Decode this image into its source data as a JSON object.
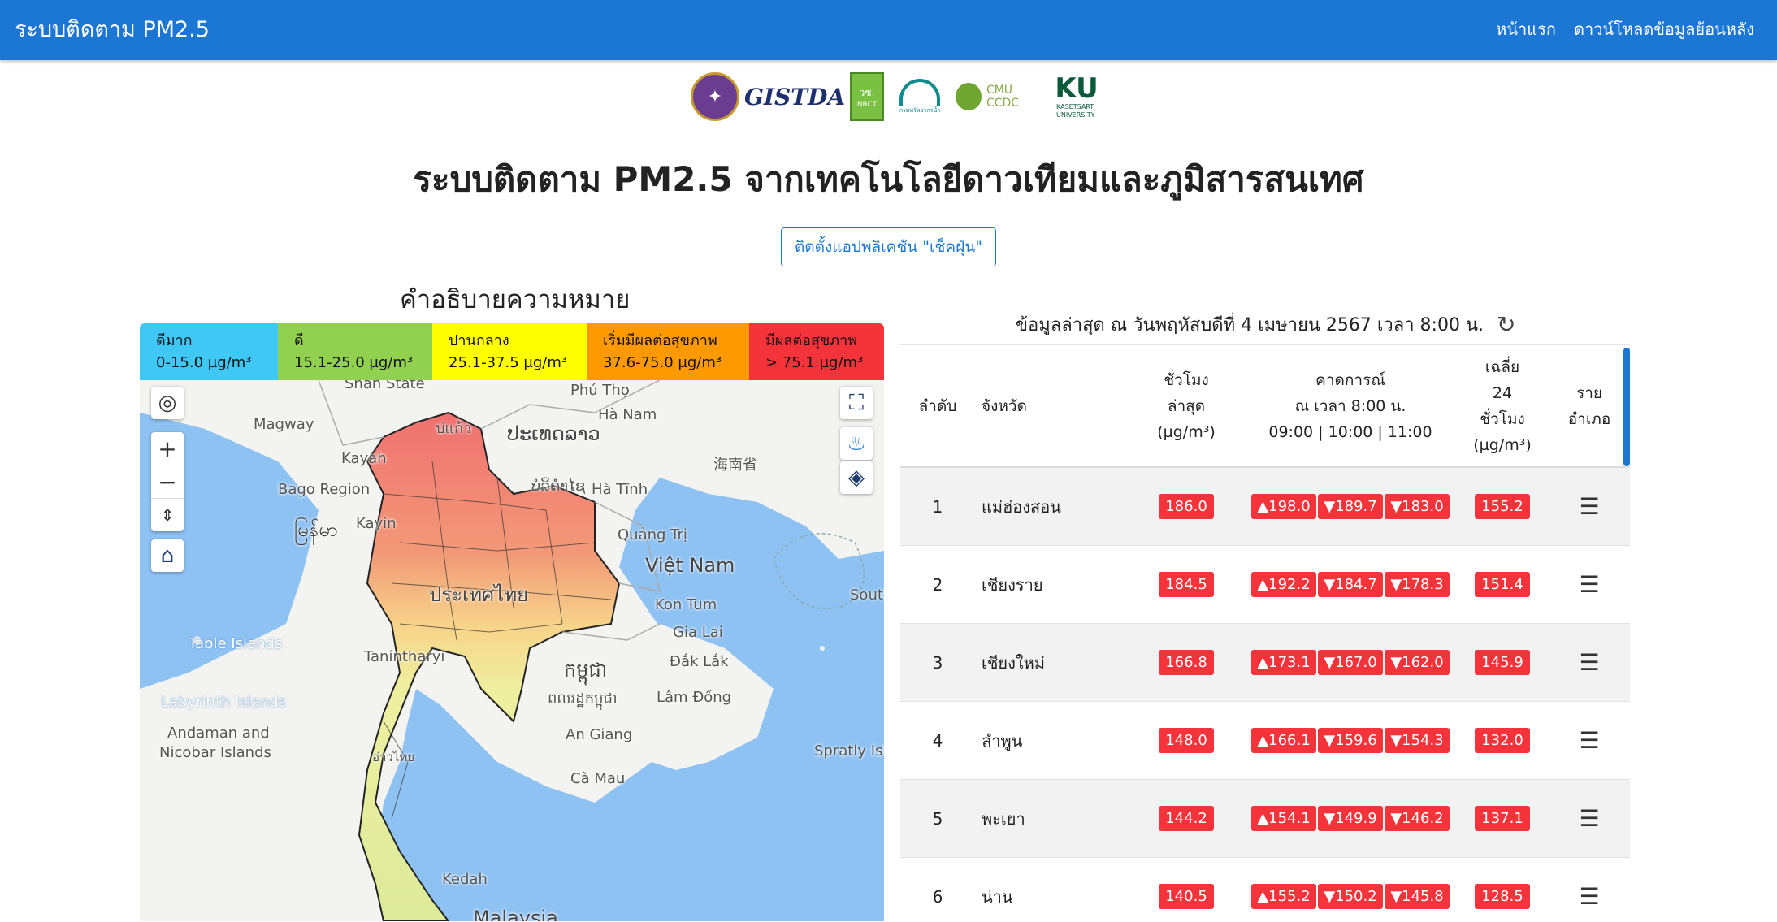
{
  "navbar": {
    "brand": "ระบบติดตาม PM2.5",
    "links": [
      "หน้าแรก",
      "ดาวน์โหลดข้อมูลย้อนหลัง"
    ]
  },
  "logos": {
    "gistda": "GISTDA",
    "nrct": "วช.",
    "nrct_sub": "NRCT",
    "dept": "กรมทรัพยากรน้ำ",
    "ccdc": "CMU CCDC",
    "ku": "KU",
    "ku_sub": "KASETSART UNIVERSITY"
  },
  "page_title": "ระบบติดตาม PM2.5 จากเทคโนโลยีดาวเทียมและภูมิสารสนเทศ",
  "install_button": "ติดตั้งแอปพลิเคชัน \"เช็คฝุ่น\"",
  "legend": {
    "title": "คำอธิบายความหมาย",
    "items": [
      {
        "label": "ดีมาก",
        "range": "0-15.0 µg/m³",
        "color": "#3fc7f5"
      },
      {
        "label": "ดี",
        "range": "15.1-25.0 µg/m³",
        "color": "#92d050"
      },
      {
        "label": "ปานกลาง",
        "range": "25.1-37.5 µg/m³",
        "color": "#ffff00"
      },
      {
        "label": "เริ่มมีผลต่อสุขภาพ",
        "range": "37.6-75.0 µg/m³",
        "color": "#ff9900"
      },
      {
        "label": "มีผลต่อสุขภาพ",
        "range": "> 75.1 µg/m³",
        "color": "#f5333a"
      }
    ]
  },
  "map": {
    "labels": {
      "shan": "Shan State",
      "phutho": "Phú Thọ",
      "hanam": "Hà Nam",
      "magway": "Magway",
      "bokeo": "บ่แก้ว",
      "laos": "ປະເທດລາວ",
      "hainan": "海南省",
      "kayah": "Kayah",
      "bago": "Bago Region",
      "bolikhamxay": "ບໍລິຄໍາໄຊ",
      "hatinh": "Hà Tĩnh",
      "myanmar": "မြန်မာ",
      "kayin": "Kayin",
      "quangtri": "Quảng Trị",
      "vietnam": "Việt Nam",
      "thailand": "ประเทศไทย",
      "south": "South",
      "kontum": "Kon Tum",
      "gialai": "Gia Lai",
      "table_islands": "Table Islands",
      "tanintharyi": "Tanintharyi",
      "daklak": "Đắk Lắk",
      "cambodia": "កម្ពុជា",
      "cambodia2": "ពលរដ្ឋកម្ពុជា",
      "labyrinth": "Labyrinth Islands",
      "lamdong": "Lâm Đồng",
      "andaman": "Andaman and",
      "nicobar": "Nicobar Islands",
      "angiang": "An Giang",
      "spratly": "Spratly Isla",
      "gulf": "อ่าวไทย",
      "camau": "Cà Mau",
      "kedah": "Kedah",
      "malaysia": "Malaysia"
    }
  },
  "updated": "ข้อมูลล่าสุด ณ วันพฤหัสบดีที่ 4 เมษายน 2567 เวลา 8:00 น.",
  "table": {
    "headers": {
      "rank": "ลำดับ",
      "province": "จังหวัด",
      "hour_1": "ชั่วโมง",
      "hour_2": "ล่าสุด",
      "hour_3": "(µg/m³)",
      "fc_1": "คาดการณ์",
      "fc_2": "ณ เวลา 8:00 น.",
      "fc_3": "09:00 | 10:00 | 11:00",
      "avg_1": "เฉลี่ย",
      "avg_2": "24",
      "avg_3": "ชั่วโมง",
      "avg_4": "(µg/m³)",
      "district_1": "ราย",
      "district_2": "อำเภอ"
    },
    "rows": [
      {
        "rank": "1",
        "province": "แม่ฮ่องสอน",
        "latest": "186.0",
        "f1": "▲198.0",
        "f2": "▼189.7",
        "f3": "▼183.0",
        "avg": "155.2"
      },
      {
        "rank": "2",
        "province": "เชียงราย",
        "latest": "184.5",
        "f1": "▲192.2",
        "f2": "▼184.7",
        "f3": "▼178.3",
        "avg": "151.4"
      },
      {
        "rank": "3",
        "province": "เชียงใหม่",
        "latest": "166.8",
        "f1": "▲173.1",
        "f2": "▼167.0",
        "f3": "▼162.0",
        "avg": "145.9"
      },
      {
        "rank": "4",
        "province": "ลำพูน",
        "latest": "148.0",
        "f1": "▲166.1",
        "f2": "▼159.6",
        "f3": "▼154.3",
        "avg": "132.0"
      },
      {
        "rank": "5",
        "province": "พะเยา",
        "latest": "144.2",
        "f1": "▲154.1",
        "f2": "▼149.9",
        "f3": "▼146.2",
        "avg": "137.1"
      },
      {
        "rank": "6",
        "province": "น่าน",
        "latest": "140.5",
        "f1": "▲155.2",
        "f2": "▼150.2",
        "f3": "▼145.8",
        "avg": "128.5"
      }
    ]
  }
}
